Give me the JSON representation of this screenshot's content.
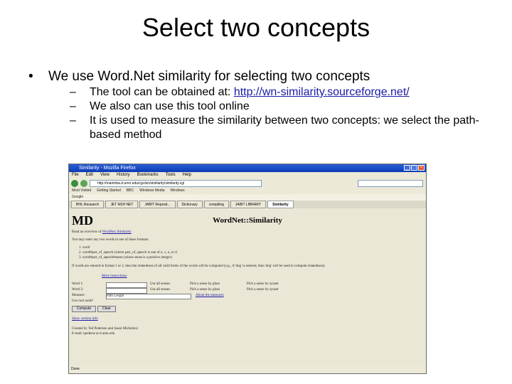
{
  "slide": {
    "title": "Select two concepts",
    "bullet": "We use Word.Net similarity for selecting two concepts",
    "sub1_prefix": "The tool can be obtained at: ",
    "sub1_link": "http://wn-similarity.sourceforge.net/",
    "sub2": "We also can use this tool online",
    "sub3": "It is used to measure the similarity between two concepts: we select the path-based method"
  },
  "browser": {
    "window_title": "Similarity - Mozilla Firefox",
    "menu": [
      "File",
      "Edit",
      "View",
      "History",
      "Bookmarks",
      "Tools",
      "Help"
    ],
    "url": "http://marimba.d.umn.edu/cgi-bin/similarity/similarity.cgi",
    "bookmarks": [
      "Most Visited",
      "Getting Started",
      "BBC",
      "Windows Media",
      "Windows"
    ],
    "google_label": "Google",
    "tabs": [
      "BHL Research",
      "JET NSH NET",
      "JABIT Reposit...",
      "Dictionary",
      "compiling",
      "JABIT LIBRARY",
      "Similarity"
    ],
    "page": {
      "logo": "MD",
      "title": "WordNet::Similarity",
      "overview_prefix": "Read an overview of ",
      "overview_link": "WordNet::Similarity",
      "intro": "You may enter any two words in one of these formats:",
      "formats": [
        "1. word",
        "2. word#part_of_speech (where part_of_speech is one of n, v, a, or r)",
        "3. word#part_of_speech#sense (where sense is a positive integer)"
      ],
      "note": "If words are entered in format 1 or 2, then the relatedness of all valid forms of the words will be computed (e.g., if 'dog' is entered, then 'dog' will be used to compute relatedness).",
      "more_link": "More instructions",
      "word1_label": "Word 1:",
      "word2_label": "Word 2:",
      "measure_label": "Measure:",
      "measure_value": "Path Length",
      "use_all_senses": "Use all senses",
      "pick_gloss": "Pick a sense by gloss",
      "pick_synset": "Pick a sense by synset",
      "about_measures": "About the measures",
      "use_root": "Use root node?",
      "compute_btn": "Compute",
      "clear_btn": "Clear",
      "show_version": "Show version info",
      "credits1": "Created by Ted Pedersen and Jason Michelizzi",
      "credits2": "E-mail: tpederse at d.umn.edu"
    },
    "status": "Done"
  }
}
